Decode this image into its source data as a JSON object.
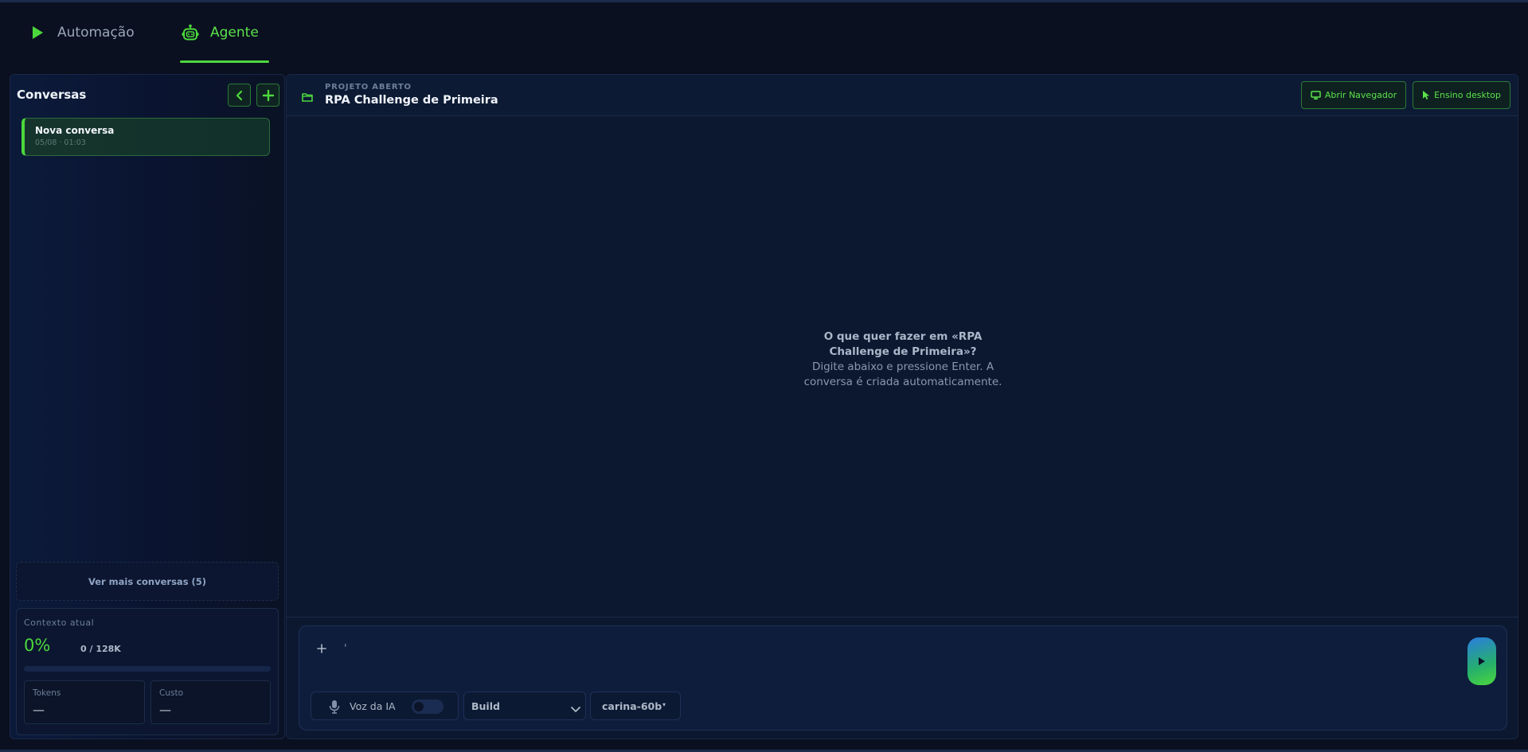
{
  "tabs": [
    {
      "label": "Automação",
      "icon": "play-icon",
      "active": false
    },
    {
      "label": "Agente",
      "icon": "robot-icon",
      "active": true
    }
  ],
  "sidebar": {
    "title": "Conversas",
    "conversations": [
      {
        "name": "Nova conversa",
        "date": "05/08 · 01:03",
        "active": true
      }
    ],
    "more_label": "Ver mais conversas (5)",
    "context": {
      "label": "Contexto atual",
      "percent_text": "0%",
      "count": "0 / 128K",
      "usage_fraction": 0
    },
    "stats": {
      "tokens_label": "Tokens",
      "tokens_value": "—",
      "cost_label": "Custo",
      "cost_value": "—"
    }
  },
  "main": {
    "project_label": "PROJETO ABERTO",
    "project_name": "RPA Challenge de Primeira",
    "buttons": {
      "browser": "Abrir Navegador",
      "desktop": "Ensino desktop"
    },
    "empty_state": {
      "title": "O que quer fazer em «RPA Challenge de Primeira»?",
      "subtitle": "Digite abaixo e pressione Enter. A conversa é criada automaticamente."
    }
  },
  "composer": {
    "input_value": "",
    "input_placeholder": "'",
    "voice_label": "Voz da IA",
    "voice_enabled": false,
    "mode": "Build",
    "model": "carina-60b",
    "model_caret": "▾"
  },
  "colors": {
    "accent": "#4cd83c",
    "background": "#0a1020",
    "panel": "#0c1830",
    "border": "#172747"
  }
}
